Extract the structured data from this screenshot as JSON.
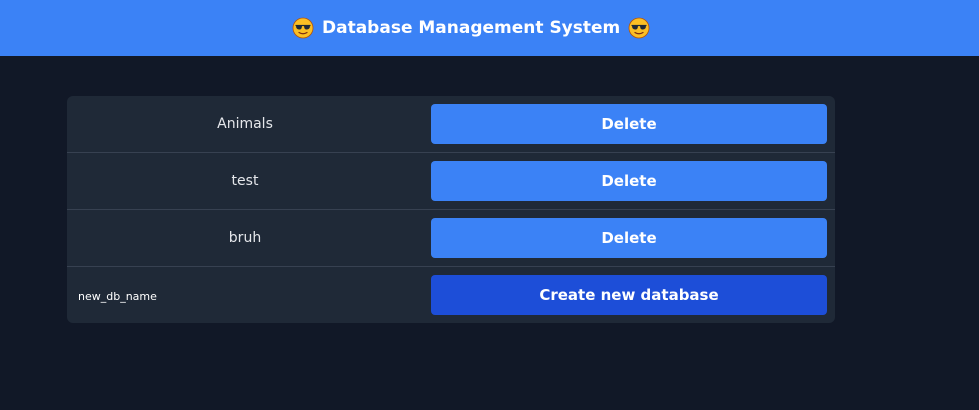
{
  "header": {
    "title": "Database Management System",
    "left_icon": "sunglasses-face-icon",
    "right_icon": "sunglasses-face-icon",
    "background": "#3b82f6"
  },
  "databases": [
    {
      "name": "Animals",
      "delete_label": "Delete"
    },
    {
      "name": "test",
      "delete_label": "Delete"
    },
    {
      "name": "bruh",
      "delete_label": "Delete"
    }
  ],
  "create": {
    "placeholder": "new_db_name",
    "value": "",
    "button_label": "Create new database"
  },
  "colors": {
    "page_background": "#111827",
    "panel_background": "#1f2937",
    "delete_button": "#3b82f6",
    "create_button": "#1d4ed8"
  }
}
